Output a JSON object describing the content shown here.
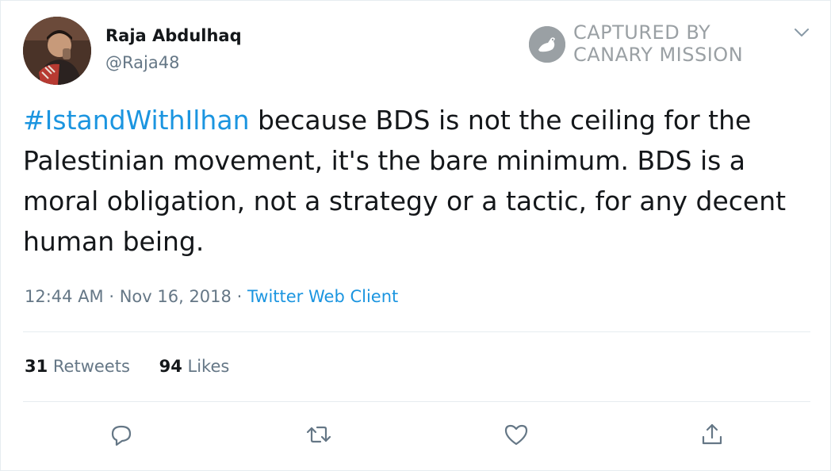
{
  "tweet": {
    "author_name": "Raja Abdulhaq",
    "author_handle": "@Raja48",
    "hashtag": "#IstandWithIlhan",
    "body": " because BDS is not the ceiling for the Palestinian movement, it's the bare minimum. BDS is a moral obligation, not a strategy or a tactic, for any decent human being.",
    "time": "12:44 AM",
    "date": "Nov 16, 2018",
    "separator": " · ",
    "source": "Twitter Web Client"
  },
  "stats": {
    "retweets_count": "31",
    "retweets_label": " Retweets",
    "likes_count": "94",
    "likes_label": " Likes"
  },
  "watermark": {
    "line1": "CAPTURED BY",
    "line2": "CANARY MISSION"
  },
  "icons": {
    "menu": "chevron-down-icon",
    "reply": "reply-icon",
    "retweet": "retweet-icon",
    "like": "heart-icon",
    "share": "share-icon"
  },
  "colors": {
    "link": "#1b95e0",
    "secondary_text": "#657786",
    "primary_text": "#14171a",
    "watermark": "#9aa0a4"
  }
}
